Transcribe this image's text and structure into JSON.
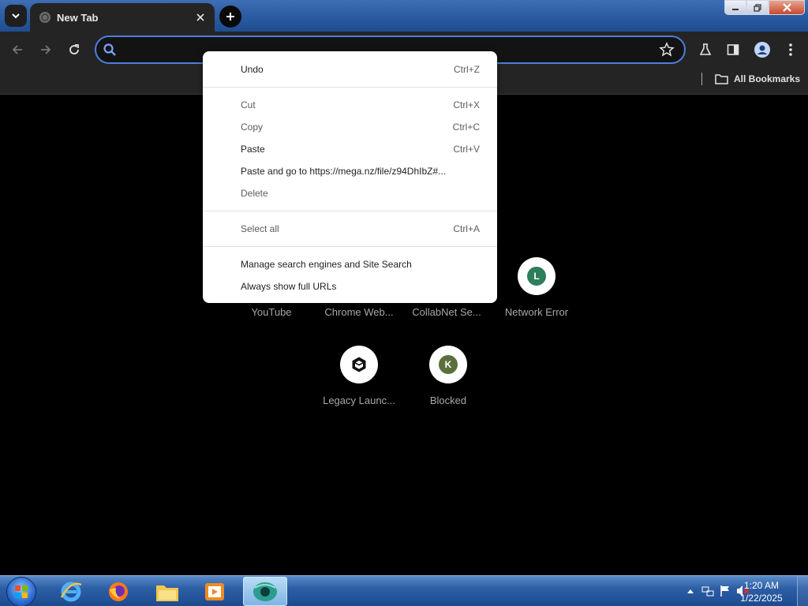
{
  "tab": {
    "title": "New Tab"
  },
  "omnibox": {
    "value": "",
    "placeholder": ""
  },
  "bookmarks": {
    "all_label": "All Bookmarks"
  },
  "shortcuts": [
    {
      "label": "YouTube"
    },
    {
      "label": "Chrome Web..."
    },
    {
      "label": "CollabNet Se..."
    },
    {
      "label": "Network Error",
      "letter": "L",
      "color": "#2e7d5b"
    },
    {
      "label": "Legacy Launc..."
    },
    {
      "label": "Blocked",
      "letter": "K",
      "color": "#5b6f3c"
    }
  ],
  "context_menu": {
    "undo": {
      "label": "Undo",
      "shortcut": "Ctrl+Z"
    },
    "cut": {
      "label": "Cut",
      "shortcut": "Ctrl+X"
    },
    "copy": {
      "label": "Copy",
      "shortcut": "Ctrl+C"
    },
    "paste": {
      "label": "Paste",
      "shortcut": "Ctrl+V"
    },
    "paste_go": {
      "label": "Paste and go to https://mega.nz/file/z94DhIbZ#..."
    },
    "delete": {
      "label": "Delete"
    },
    "select_all": {
      "label": "Select all",
      "shortcut": "Ctrl+A"
    },
    "manage": {
      "label": "Manage search engines and Site Search"
    },
    "full_urls": {
      "label": "Always show full URLs"
    }
  },
  "taskbar": {
    "time": "1:20 AM",
    "date": "1/22/2025"
  },
  "colors": {
    "accent": "#4d7fe0",
    "toolbar": "#242424",
    "page_bg": "#000000"
  }
}
